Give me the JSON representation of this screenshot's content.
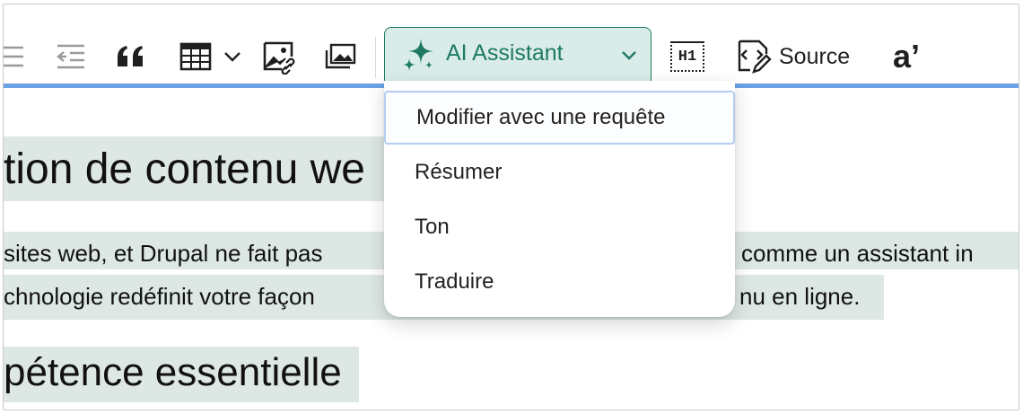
{
  "toolbar": {
    "ai_assistant_label": "AI Assistant",
    "heading_button_text": "H1",
    "source_label": "Source",
    "special_chars_text": "a’"
  },
  "menu": {
    "items": [
      {
        "label": "Modifier avec une requête",
        "active": true
      },
      {
        "label": "Résumer"
      },
      {
        "label": "Ton"
      },
      {
        "label": "Traduire"
      }
    ]
  },
  "content": {
    "heading1_partial": "tion de contenu we",
    "para_line1_left": "sites web, et Drupal ne fait pas",
    "para_line1_right": "comme un assistant in",
    "para_line2_left": "chnologie redéfinit votre façon",
    "para_line2_right": "nu en ligne.",
    "heading2_partial": "pétence essentielle"
  },
  "colors": {
    "ai_accent": "#1e7a65",
    "ai_background": "#d9ece8",
    "highlight": "#dde7e3",
    "focus_border": "#6aa2e4"
  }
}
